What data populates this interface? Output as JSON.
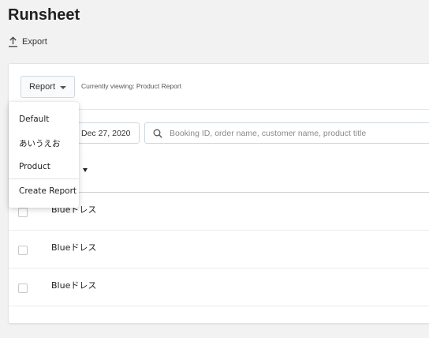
{
  "page": {
    "title": "Runsheet",
    "export_label": "Export"
  },
  "toolbar": {
    "report_button_label": "Report",
    "viewing_text": "Currently viewing: Product Report"
  },
  "filters": {
    "date_value": "Dec 27, 2020",
    "search_placeholder": "Booking ID, order name, customer name, product title"
  },
  "dropdown": {
    "items": [
      {
        "label": "Default"
      },
      {
        "label": "あいうえお"
      },
      {
        "label": "Product"
      }
    ],
    "create_label": "Create Report"
  },
  "table": {
    "rows": [
      {
        "name": "Blueドレス",
        "checked": false
      },
      {
        "name": "Blueドレス",
        "checked": false
      },
      {
        "name": "Blueドレス",
        "checked": false
      }
    ]
  }
}
